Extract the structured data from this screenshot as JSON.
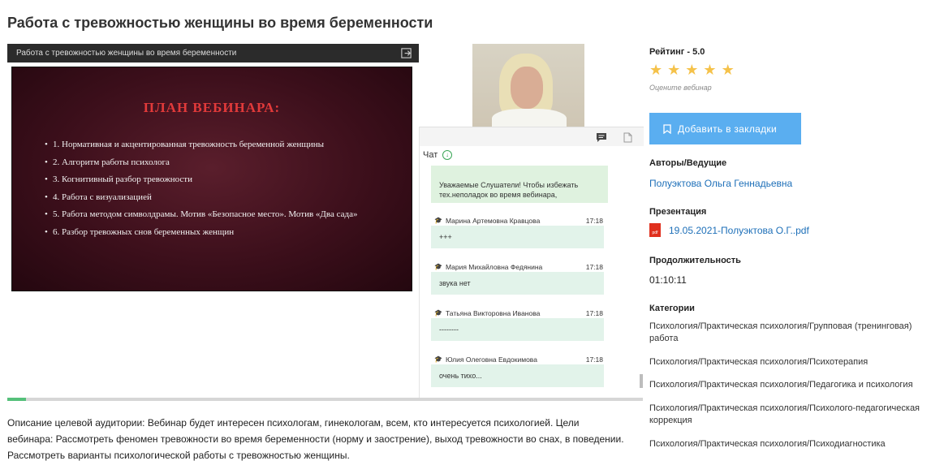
{
  "page": {
    "title": "Работа с тревожностью женщины во время беременности"
  },
  "player": {
    "header_title": "Работа с тревожностью женщины во время беременности",
    "progress_percent": 3,
    "slide": {
      "title": "ПЛАН ВЕБИНАРА:",
      "items": [
        "1. Нормативная и акцентированная тревожность беременной женщины",
        "2. Алгоритм работы психолога",
        "3. Когнитивный разбор тревожности",
        "4. Работа с визуализацией",
        "5. Работа методом символдрамы. Мотив «Безопасное место».  Мотив «Два сада»",
        "6. Разбор тревожных снов беременных женщин"
      ]
    },
    "chat": {
      "label": "Чат",
      "notice": "Уважаемые Слушатели! Чтобы избежать тех.неполадок во время вебинара,",
      "messages": [
        {
          "author": "Марина Артемовна Кравцова",
          "time": "17:18",
          "text": "+++"
        },
        {
          "author": "Мария Михайловна Федянина",
          "time": "17:18",
          "text": "звука нет"
        },
        {
          "author": "Татьяна Викторовна Иванова",
          "time": "17:18",
          "text": "--------"
        },
        {
          "author": "Юлия Олеговна Евдокимова",
          "time": "17:18",
          "text": "очень тихо..."
        }
      ]
    }
  },
  "sidebar": {
    "rating_label": "Рейтинг - 5.0",
    "rating_value": 5,
    "rate_hint": "Оцените вебинар",
    "bookmark_label": "Добавить в закладки",
    "authors_label": "Авторы/Ведущие",
    "author": "Полуэктова Ольга Геннадьевна",
    "presentation_label": "Презентация",
    "presentation_file": "19.05.2021-Полуэктова О.Г..pdf",
    "pdf_badge": "pdf",
    "duration_label": "Продолжительность",
    "duration": "01:10:11",
    "categories_label": "Категории",
    "categories": [
      "Психология/Практическая психология/Групповая (тренинговая) работа",
      "Психология/Практическая психология/Психотерапия",
      "Психология/Практическая психология/Педагогика и психология",
      "Психология/Практическая психология/Психолого-педагогическая коррекция",
      "Психология/Практическая психология/Психодиагностика"
    ]
  },
  "description": "Описание целевой аудитории: Вебинар будет интересен психологам, гинекологам, всем, кто интересуется психологией. Цели вебинара: Рассмотреть феномен тревожности во время беременности (норму и заострение), выход тревожности во снах, в поведении. Рассмотреть варианты психологической работы с тревожностью женщины.",
  "colors": {
    "accent": "#5aaef0",
    "link": "#1d6fb8",
    "star": "#f5c24a",
    "chat_bubble": "#e2f3ea",
    "progress": "#55c07a"
  }
}
